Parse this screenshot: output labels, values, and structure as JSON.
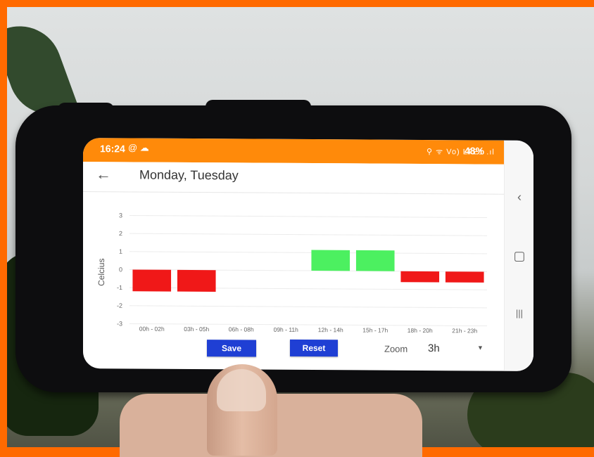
{
  "status_bar": {
    "time": "16:24",
    "left_icons": "@ ☁",
    "right_icons": "⚲ ᯤ Vo) LTE1 .ıl",
    "battery": "48%"
  },
  "app_bar": {
    "title": "Monday, Tuesday",
    "back_icon": "arrow-back-icon"
  },
  "nav_bar": {
    "back": "‹",
    "home": "▢",
    "recents": "|||"
  },
  "buttons": {
    "save_label": "Save",
    "reset_label": "Reset"
  },
  "zoom": {
    "label": "Zoom",
    "value": "3h"
  },
  "colors": {
    "status_bar": "#ff8a0a",
    "button": "#1f3fd4",
    "positive_bar": "#4cf060",
    "negative_bar": "#f01818"
  },
  "chart_data": {
    "type": "bar",
    "ylabel": "Celcius",
    "xlabel": "",
    "ylim": [
      -3,
      3
    ],
    "y_ticks": [
      "3",
      "2",
      "1",
      "0",
      "-1",
      "-2",
      "-3"
    ],
    "categories": [
      "00h - 02h",
      "03h - 05h",
      "06h - 08h",
      "09h - 11h",
      "12h - 14h",
      "15h - 17h",
      "18h - 20h",
      "21h - 23h"
    ],
    "values": [
      -1.2,
      -1.2,
      0,
      0,
      1.15,
      1.15,
      -0.6,
      -0.6
    ],
    "grid": true
  }
}
